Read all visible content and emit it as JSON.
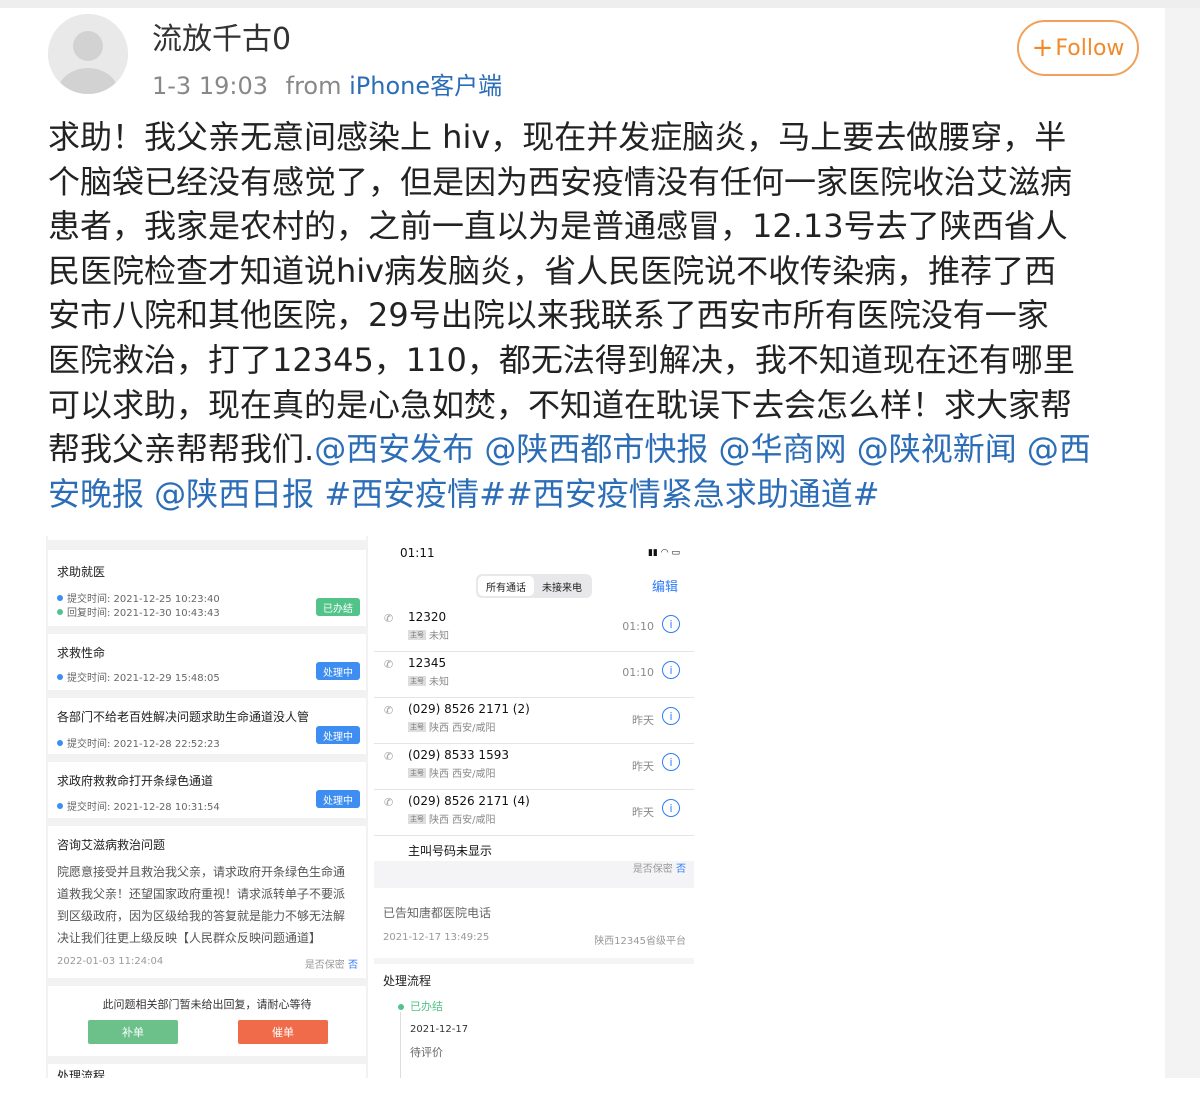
{
  "author": {
    "name": "流放千古0",
    "time": "1-3 19:03",
    "from_word": "from",
    "source": "iPhone客户端"
  },
  "follow_label": "Follow",
  "post": {
    "lines": [
      "求助！我父亲无意间感染上 hiv，现在并发症脑炎，马上要去做腰穿，半",
      "个脑袋已经没有感觉了，但是因为西安疫情没有任何一家医院收治艾滋病",
      "患者，我家是农村的，之前一直以为是普通感冒，12.13号去了陕西省人",
      "民医院检查才知道说hiv病发脑炎，省人民医院说不收传染病，推荐了西",
      "安市八院和其他医院，29号出院以来我联系了西安市所有医院没有一家",
      "医院救治，打了12345，110，都无法得到解决，我不知道现在还有哪里",
      "可以求助，现在真的是心急如焚，不知道在耽误下去会怎么样！求大家帮"
    ],
    "line8_text": "帮我父亲帮帮我们.",
    "line8_links": "@西安发布 @陕西都市快报 @华商网 @陕视新闻 @西",
    "line9_links": "安晚报 @陕西日报 #西安疫情##西安疫情紧急求助通道#"
  },
  "left_shot": {
    "cards": [
      {
        "title": "求助就医",
        "submit": "提交时间:  2021-12-25 10:23:40",
        "reply": "回复时间:  2021-12-30 10:43:43",
        "status": "已办结"
      },
      {
        "title": "求救性命",
        "submit": "提交时间:  2021-12-29 15:48:05",
        "status": "处理中"
      },
      {
        "title": "各部门不给老百姓解决问题求助生命通道没人管",
        "submit": "提交时间:  2021-12-28 22:52:23",
        "status": "处理中"
      },
      {
        "title": "求政府救救命打开条绿色通道",
        "submit": "提交时间:  2021-12-28 10:31:54",
        "status": "处理中"
      }
    ],
    "detail_title": "咨询艾滋病救治问题",
    "detail_lines": [
      "院愿意接受并且救治我父亲，请求政府开条绿色生命通",
      "道救我父亲！还望国家政府重视！请求派转单子不要派",
      "到区级政府，因为区级给我的答复就是能力不够无法解",
      "决让我们往更上级反映【人民群众反映问题通道】"
    ],
    "detail_date": "2022-01-03 11:24:04",
    "confidential_label": "是否保密",
    "confidential_value": "否",
    "wait_notice": "此问题相关部门暂未给出回复，请耐心等待",
    "btn_supplement": "补单",
    "btn_urge": "催单",
    "process_label": "处理流程"
  },
  "right_shot": {
    "time": "01:11",
    "tab_all": "所有通话",
    "tab_missed": "未接来电",
    "edit": "编辑",
    "calls": [
      {
        "number": "12320",
        "location": "未知",
        "when": "01:10"
      },
      {
        "number": "12345",
        "location": "未知",
        "when": "01:10"
      },
      {
        "number": "(029) 8526 2171 (2)",
        "location": "陕西 西安/咸阳",
        "when": "昨天"
      },
      {
        "number": "(029) 8533 1593",
        "location": "陕西 西安/咸阳",
        "when": "昨天"
      },
      {
        "number": "(029) 8526 2171 (4)",
        "location": "陕西 西安/咸阳",
        "when": "昨天"
      }
    ],
    "cut_row": "主叫号码未显示",
    "confidential_label": "是否保密",
    "confidential_value": "否",
    "notice": "已告知唐都医院电话",
    "notice_date": "2021-12-17 13:49:25",
    "notice_platform": "陕西12345省级平台",
    "process_label": "处理流程",
    "step1": "已办结",
    "step_date": "2021-12-17",
    "step2": "待评价"
  },
  "colors": {
    "link": "#2c6db8",
    "follow": "#f08a2b",
    "green_badge": "#52c48a",
    "blue_badge": "#3d8ef0",
    "ios_blue": "#2f7cf6"
  }
}
